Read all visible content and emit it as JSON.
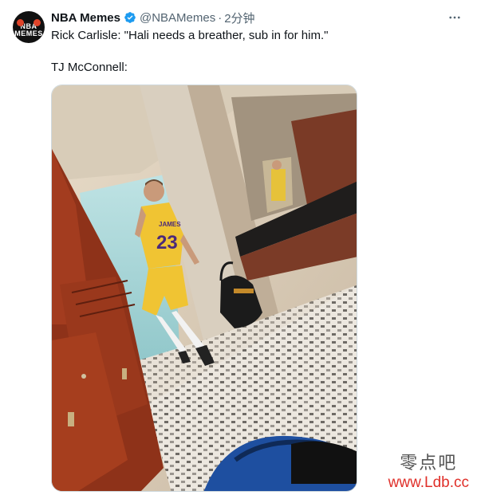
{
  "tweet": {
    "author_name": "NBA Memes",
    "handle": "@NBAMemes",
    "separator": "·",
    "time": "2分钟",
    "text_line1": "Rick Carlisle: \"Hali needs a breather, sub in for him.\"",
    "text_line2": "TJ McConnell:",
    "verified_color": "#1d9bf0"
  },
  "avatar": {
    "logo_top": "NBA",
    "logo_bottom": "MEMES"
  },
  "photo": {
    "jersey_name": "JAMES",
    "jersey_number": "23"
  },
  "watermark": {
    "chinese": "零点吧",
    "url": "www.Ldb.cc"
  },
  "icons": {
    "more": "more-icon",
    "verified": "verified-badge-icon"
  }
}
